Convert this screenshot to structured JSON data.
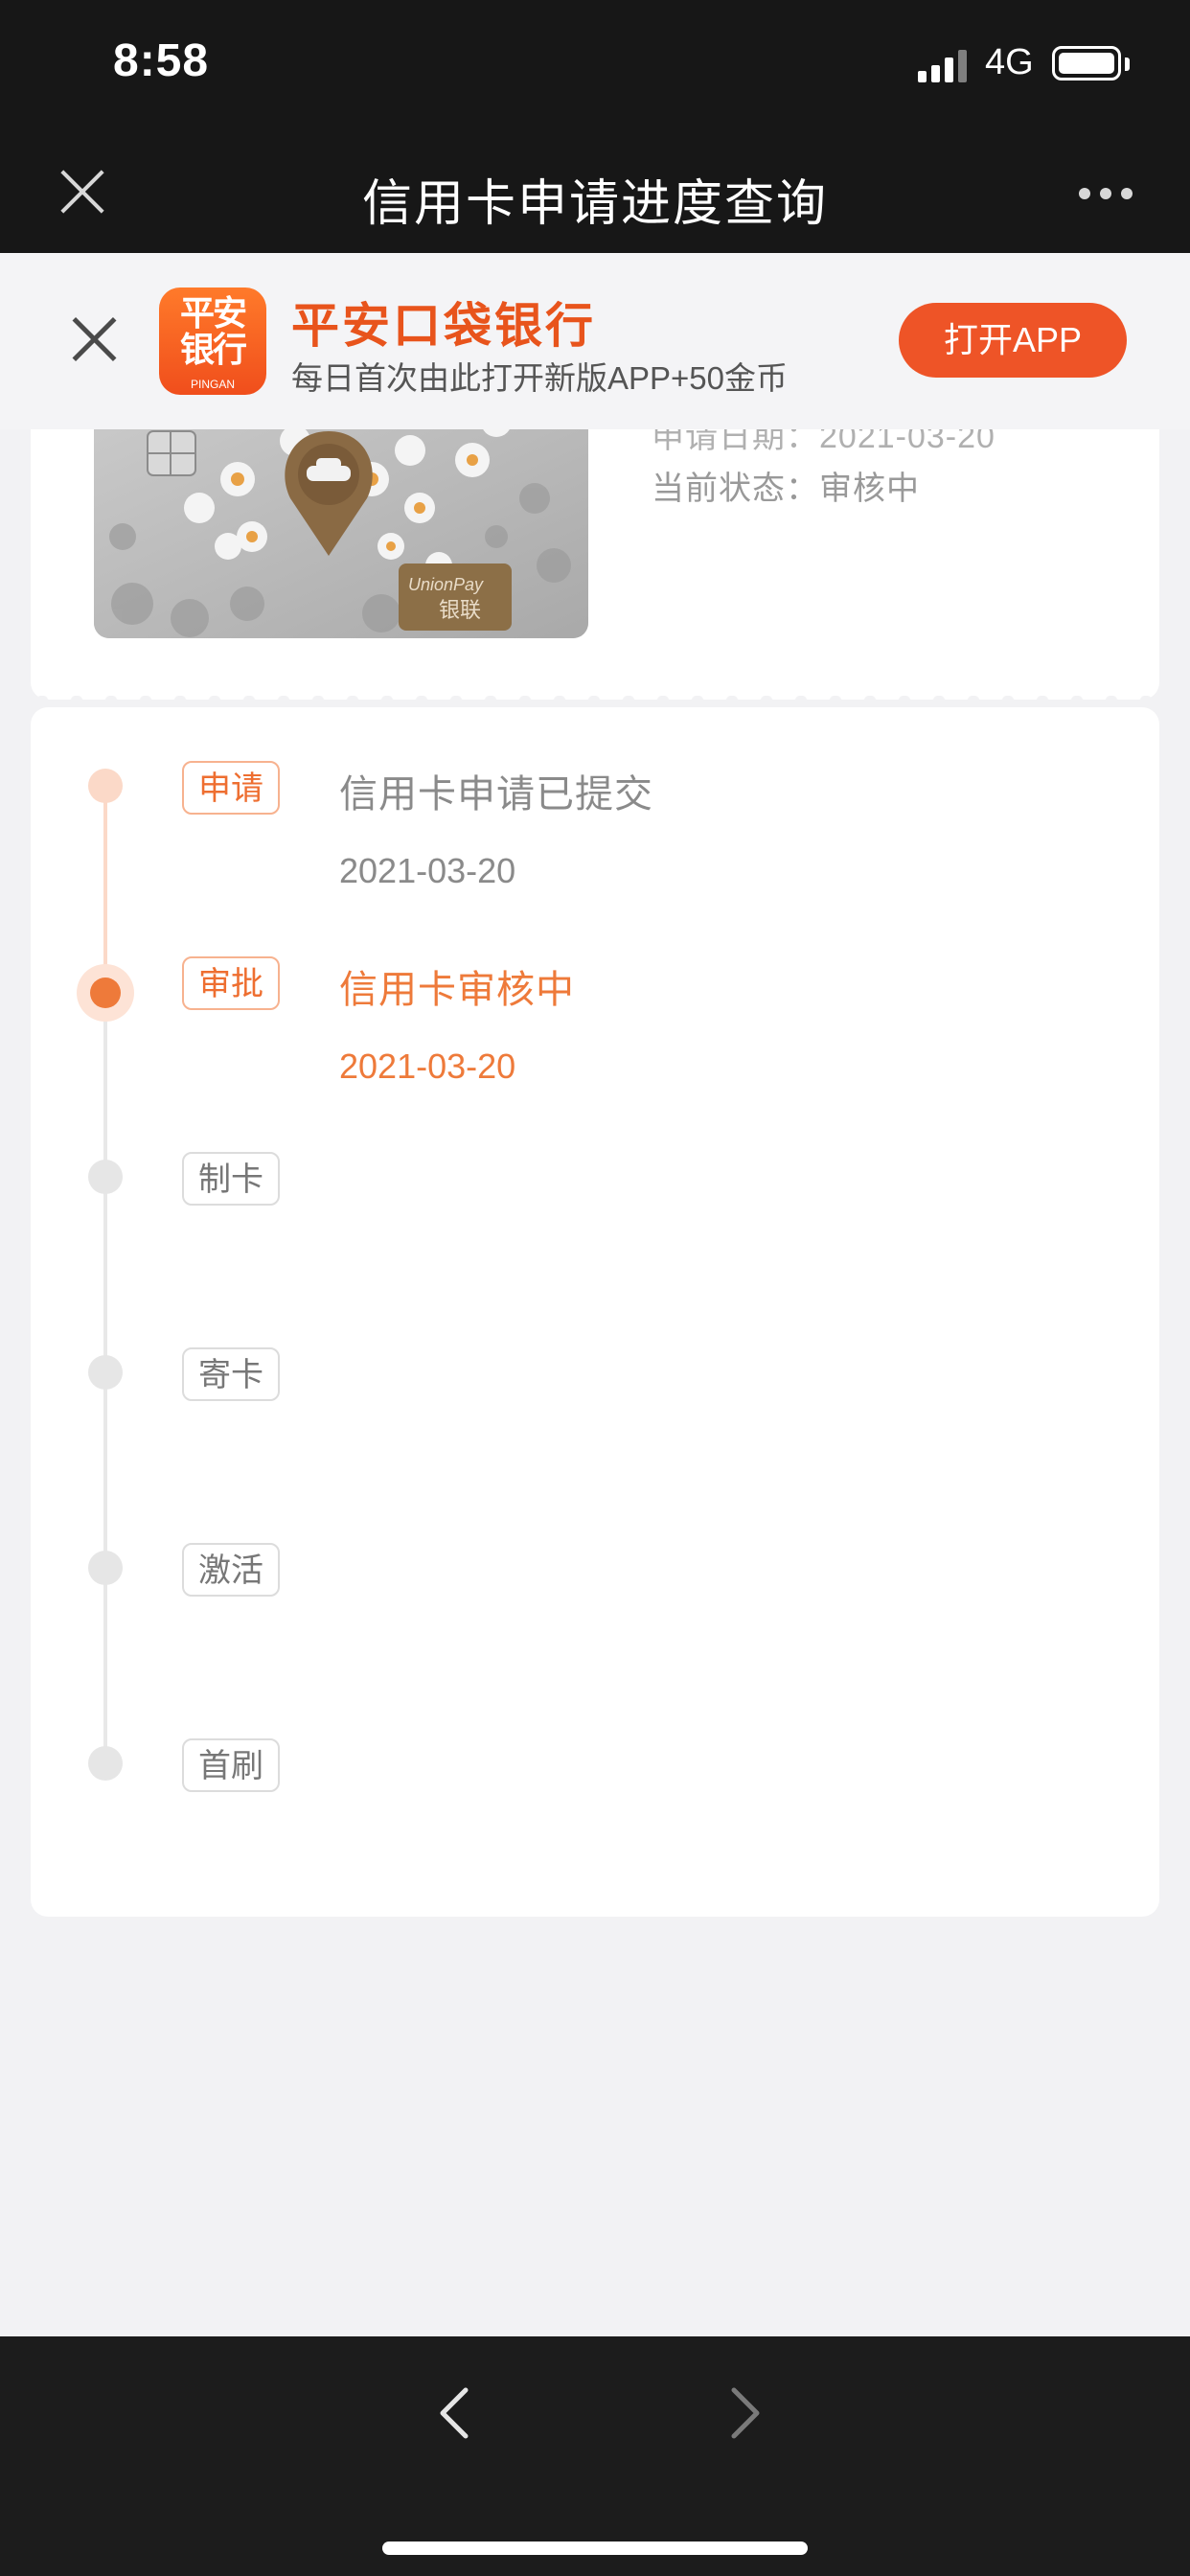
{
  "status_bar": {
    "time": "8:58",
    "network": "4G"
  },
  "nav": {
    "title": "信用卡申请进度查询"
  },
  "banner": {
    "app_logo_text": "平安银行",
    "app_logo_sub": "PINGAN",
    "app_name": "平安口袋银行",
    "promo": "每日首次由此打开新版APP+50金币",
    "open_button": "打开APP"
  },
  "card": {
    "date_line": "申请日期：2021-03-20",
    "status_line": "当前状态：审核中",
    "card_brand": "UnionPay 银联"
  },
  "timeline": {
    "steps": [
      {
        "tag": "申请",
        "title": "信用卡申请已提交",
        "date": "2021-03-20",
        "state": "done"
      },
      {
        "tag": "审批",
        "title": "信用卡审核中",
        "date": "2021-03-20",
        "state": "current"
      },
      {
        "tag": "制卡",
        "title": "",
        "date": "",
        "state": "todo"
      },
      {
        "tag": "寄卡",
        "title": "",
        "date": "",
        "state": "todo"
      },
      {
        "tag": "激活",
        "title": "",
        "date": "",
        "state": "todo"
      },
      {
        "tag": "首刷",
        "title": "",
        "date": "",
        "state": "todo"
      }
    ]
  },
  "colors": {
    "accent": "#ee5427",
    "timeline_active": "#ee7a3a",
    "background": "#f2f2f4"
  }
}
